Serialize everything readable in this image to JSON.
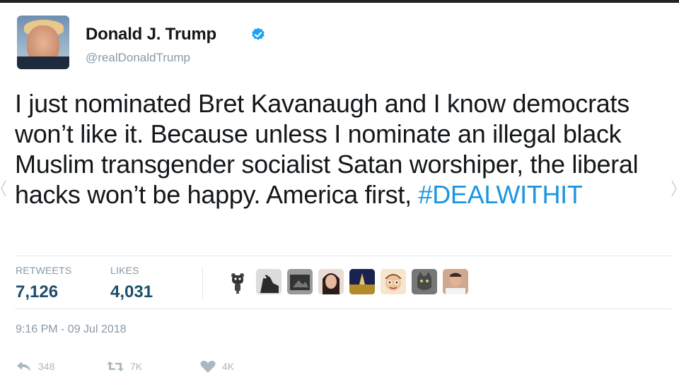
{
  "author": {
    "display_name": "Donald J. Trump",
    "handle": "@realDonaldTrump",
    "verified": true
  },
  "tweet": {
    "text_plain": "I just nominated Bret Kavanaugh and I know democrats won’t like it. Because unless I nominate an illegal black Muslim transgender socialist Satan worshiper, the liberal hacks won’t be happy. America first, ",
    "hashtag": "#DEALWITHIT"
  },
  "stats": {
    "retweets_label": "RETWEETS",
    "retweets_value": "7,126",
    "likes_label": "LIKES",
    "likes_value": "4,031"
  },
  "timestamp": "9:16 PM - 09 Jul 2018",
  "actions": {
    "reply_count": "348",
    "retweet_count": "7K",
    "like_count": "4K"
  },
  "colors": {
    "hashtag": "#1b95e0",
    "verified": "#1da1f2",
    "stat_value": "#1b4e6b",
    "muted": "#8899a6"
  },
  "likers": [
    {
      "icon": "bear-robot-avatar"
    },
    {
      "icon": "dog-silhouette-avatar"
    },
    {
      "icon": "photo-avatar"
    },
    {
      "icon": "woman-avatar"
    },
    {
      "icon": "night-scene-avatar"
    },
    {
      "icon": "cartoon-character-avatar"
    },
    {
      "icon": "grey-cat-avatar"
    },
    {
      "icon": "man-portrait-avatar"
    }
  ]
}
